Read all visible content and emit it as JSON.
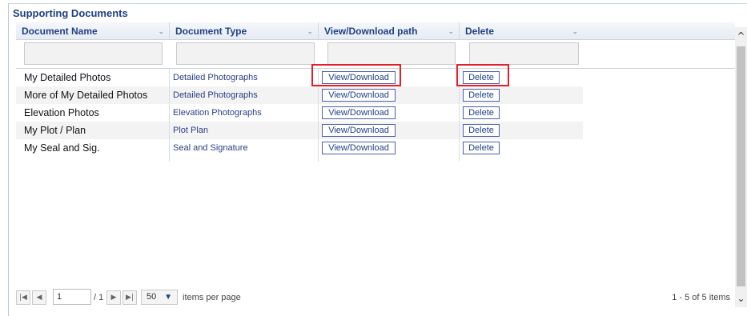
{
  "section": {
    "title": "Supporting Documents"
  },
  "columns": [
    {
      "label": "Document Name",
      "sort_icon": "chevron-down"
    },
    {
      "label": "Document Type",
      "sort_icon": "chevron-down"
    },
    {
      "label": "View/Download path",
      "sort_icon": "chevron-down"
    },
    {
      "label": "Delete",
      "sort_icon": "chevron-down"
    }
  ],
  "rows": [
    {
      "name": "My Detailed Photos",
      "type": "Detailed Photographs",
      "view": "View/Download",
      "delete": "Delete"
    },
    {
      "name": "More of My Detailed Photos",
      "type": "Detailed Photographs",
      "view": "View/Download",
      "delete": "Delete"
    },
    {
      "name": "Elevation Photos",
      "type": "Elevation Photographs",
      "view": "View/Download",
      "delete": "Delete"
    },
    {
      "name": "My Plot / Plan",
      "type": "Plot Plan",
      "view": "View/Download",
      "delete": "Delete"
    },
    {
      "name": "My Seal and Sig.",
      "type": "Seal and Signature",
      "view": "View/Download",
      "delete": "Delete"
    }
  ],
  "pager": {
    "first_icon": "first-page-icon",
    "prev_icon": "prev-page-icon",
    "page_value": "1",
    "of_text": "/ 1",
    "next_icon": "next-page-icon",
    "last_icon": "last-page-icon",
    "page_size": "50",
    "items_per_page_label": "items per page",
    "summary": "1 - 5 of 5 items"
  },
  "colors": {
    "highlight": "#e0202a",
    "header_text": "#1f3f84"
  }
}
